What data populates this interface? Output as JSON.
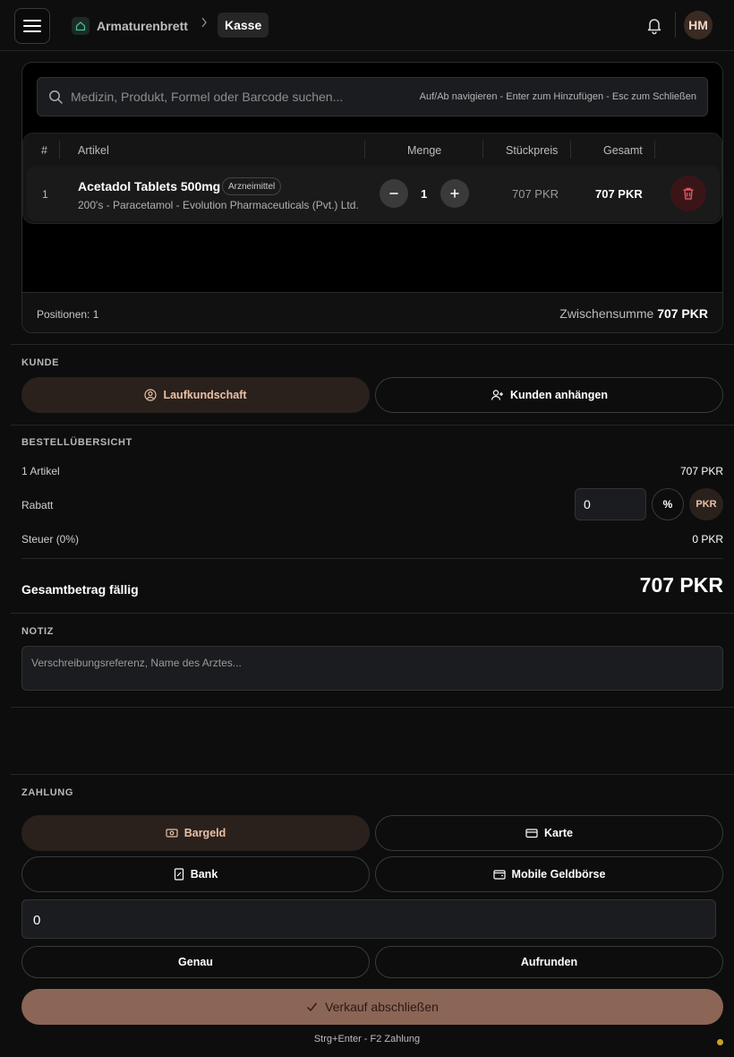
{
  "header": {
    "breadcrumb_home": "Armaturenbrett",
    "breadcrumb_separator": ">",
    "breadcrumb_current": "Kasse",
    "avatar_initials": "HM"
  },
  "search": {
    "placeholder": "Medizin, Produkt, Formel oder Barcode suchen...",
    "hint": "Auf/Ab navigieren - Enter zum Hinzufügen - Esc zum Schließen"
  },
  "cart": {
    "columns": [
      "#",
      "Artikel",
      "Menge",
      "Stückpreis",
      "Gesamt"
    ],
    "items": [
      {
        "index": "1",
        "name": "Acetadol Tablets 500mg",
        "badge": "Arzneimittel",
        "subtitle": "200's - Paracetamol - Evolution Pharmaceuticals (Pvt.) Ltd.",
        "quantity": "1",
        "unit_price": "707 PKR",
        "total": "707 PKR"
      }
    ],
    "positions_label": "Positionen: 1",
    "subtotal_label": "Zwischensumme",
    "subtotal_value": "707 PKR"
  },
  "customer": {
    "title": "KUNDE",
    "walk_in": "Laufkundschaft",
    "attach": "Kunden anhängen"
  },
  "summary": {
    "title": "BESTELLÜBERSICHT",
    "items_label": "1 Artikel",
    "items_value": "707 PKR",
    "discount_label": "Rabatt",
    "discount_value": "0",
    "discount_percent": "%",
    "discount_currency": "PKR",
    "tax_label": "Steuer (0%)",
    "tax_value": "0 PKR",
    "total_label": "Gesamtbetrag fällig",
    "total_value": "707 PKR"
  },
  "note": {
    "title": "NOTIZ",
    "placeholder": "Verschreibungsreferenz, Name des Arztes..."
  },
  "payment": {
    "title": "ZAHLUNG",
    "methods": [
      "Bargeld",
      "Karte",
      "Bank",
      "Mobile Geldbörse"
    ],
    "selected": "Bargeld",
    "amount": "0",
    "exact": "Genau",
    "round_up": "Aufrunden",
    "complete": "Verkauf abschließen",
    "shortcut": "Strg+Enter - F2 Zahlung"
  },
  "colors": {
    "accent": "#8b6556",
    "selected_bg": "#2b211c",
    "danger": "#e05560",
    "status_dot": "#c9a227"
  }
}
